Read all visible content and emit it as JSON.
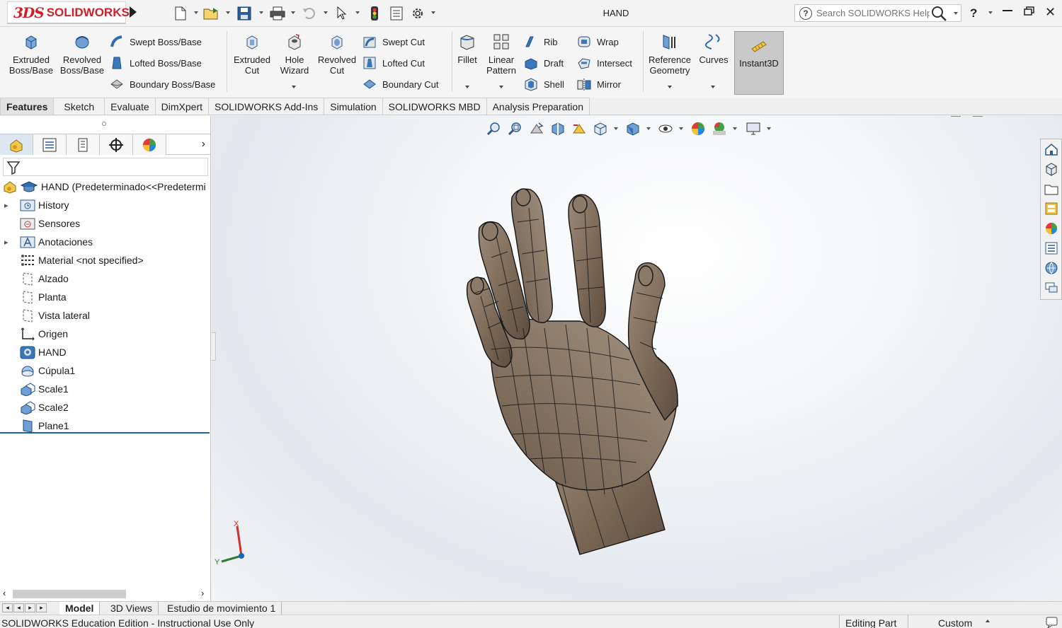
{
  "app": {
    "logo_text": "3DS SOLIDWORKS",
    "document_title": "HAND"
  },
  "search": {
    "placeholder": "Search SOLIDWORKS Help"
  },
  "ribbon": {
    "extruded_boss": [
      "Extruded",
      "Boss/Base"
    ],
    "revolved_boss": [
      "Revolved",
      "Boss/Base"
    ],
    "swept_boss": "Swept Boss/Base",
    "lofted_boss": "Lofted Boss/Base",
    "boundary_boss": "Boundary Boss/Base",
    "extruded_cut": [
      "Extruded",
      "Cut"
    ],
    "hole_wizard": [
      "Hole",
      "Wizard"
    ],
    "revolved_cut": [
      "Revolved",
      "Cut"
    ],
    "swept_cut": "Swept Cut",
    "lofted_cut": "Lofted Cut",
    "boundary_cut": "Boundary Cut",
    "fillet": "Fillet",
    "linear_pattern": [
      "Linear",
      "Pattern"
    ],
    "rib": "Rib",
    "draft": "Draft",
    "shell": "Shell",
    "wrap": "Wrap",
    "intersect": "Intersect",
    "mirror": "Mirror",
    "reference_geometry": [
      "Reference",
      "Geometry"
    ],
    "curves": "Curves",
    "instant3d": "Instant3D"
  },
  "command_tabs": [
    "Features",
    "Sketch",
    "Evaluate",
    "DimXpert",
    "SOLIDWORKS Add-Ins",
    "Simulation",
    "SOLIDWORKS MBD",
    "Analysis Preparation"
  ],
  "feature_tree": {
    "root": "HAND  (Predeterminado<<Predetermi",
    "items": [
      {
        "label": "History",
        "icon": "history-folder-icon",
        "expandable": true
      },
      {
        "label": "Sensores",
        "icon": "sensors-icon",
        "expandable": false
      },
      {
        "label": "Anotaciones",
        "icon": "annotations-icon",
        "expandable": true
      },
      {
        "label": "Material <not specified>",
        "icon": "material-icon",
        "expandable": false
      },
      {
        "label": "Alzado",
        "icon": "plane-icon",
        "expandable": false
      },
      {
        "label": "Planta",
        "icon": "plane-icon",
        "expandable": false
      },
      {
        "label": "Vista lateral",
        "icon": "plane-icon",
        "expandable": false
      },
      {
        "label": "Origen",
        "icon": "origin-icon",
        "expandable": false
      },
      {
        "label": "HAND",
        "icon": "imported-body-icon",
        "expandable": false
      },
      {
        "label": "Cúpula1",
        "icon": "dome-icon",
        "expandable": false
      },
      {
        "label": "Scale1",
        "icon": "scale-icon",
        "expandable": false
      },
      {
        "label": "Scale2",
        "icon": "scale-icon",
        "expandable": false
      },
      {
        "label": "Plane1",
        "icon": "plane-feature-icon",
        "expandable": false
      }
    ]
  },
  "triad": {
    "x": "X",
    "y": "Y"
  },
  "bottom_tabs": [
    "Model",
    "3D Views",
    "Estudio de movimiento 1"
  ],
  "status": {
    "left": "SOLIDWORKS Education Edition - Instructional Use Only",
    "mode": "Editing Part",
    "units": "Custom"
  },
  "colors": {
    "accent_red": "#d0202a",
    "model_brown": "#7d6a58",
    "selection_blue": "#1f5fa6"
  }
}
